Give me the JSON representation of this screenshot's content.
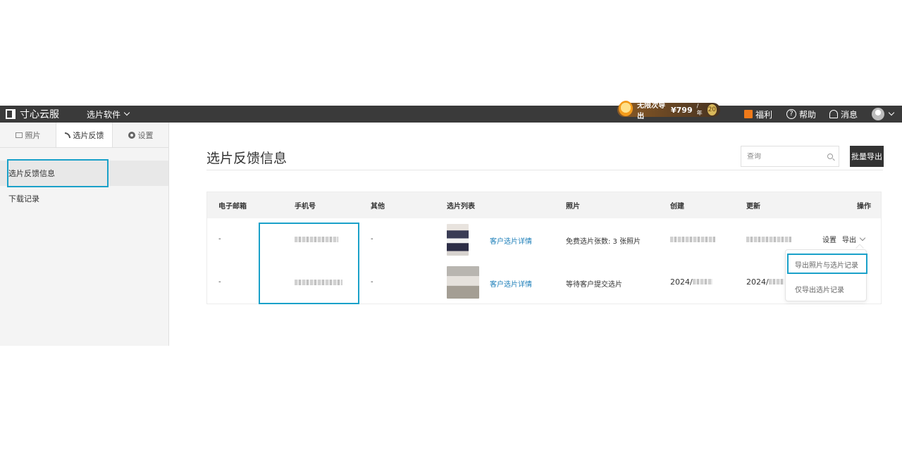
{
  "topbar": {
    "brand": "寸心云服",
    "menu_label": "选片软件",
    "promo_text": "无限次导出",
    "promo_price": "¥799",
    "promo_unit": "/年",
    "promo_badge": "20",
    "welfare_label": "福利",
    "help_label": "帮助",
    "messages_label": "消息"
  },
  "sidebar": {
    "tabs": [
      {
        "label": "照片"
      },
      {
        "label": "选片反馈"
      },
      {
        "label": "设置"
      }
    ],
    "items": [
      {
        "label": "选片反馈信息"
      },
      {
        "label": "下载记录"
      }
    ]
  },
  "main": {
    "title": "选片反馈信息",
    "search_placeholder": "查询",
    "bulk_export_label": "批量导出"
  },
  "table": {
    "columns": [
      "电子邮箱",
      "手机号",
      "其他",
      "选片列表",
      "照片",
      "创建",
      "更新",
      "操作"
    ],
    "rows": [
      {
        "email": "-",
        "other": "-",
        "detail_link": "客户选片详情",
        "photo_status": "免费选片张数: 3 张照片",
        "created": "",
        "updated": ""
      },
      {
        "email": "-",
        "other": "-",
        "detail_link": "客户选片详情",
        "photo_status": "等待客户提交选片",
        "created": "2024/",
        "updated": "2024/"
      }
    ],
    "actions": {
      "settings_label": "设置",
      "export_label": "导出"
    }
  },
  "export_dropdown": {
    "items": [
      {
        "label": "导出照片与选片记录"
      },
      {
        "label": "仅导出选片记录"
      }
    ]
  },
  "colors": {
    "topbar_bg": "#3a3a3a",
    "highlight": "#1aa1c9",
    "link": "#1a7db8"
  }
}
